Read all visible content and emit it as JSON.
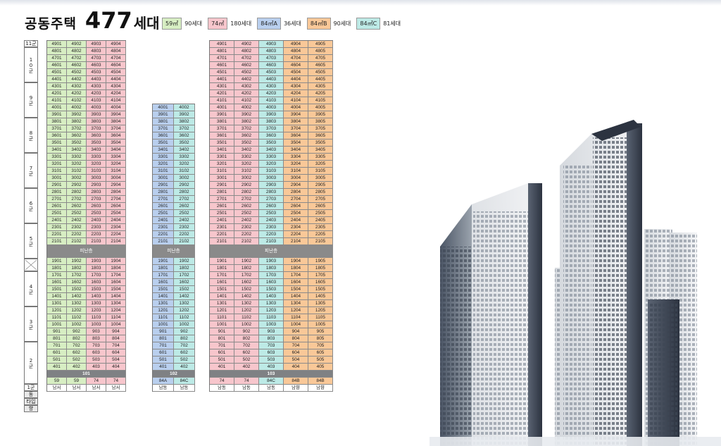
{
  "header": {
    "title_prefix": "공동주택",
    "count": "477",
    "unit": "세대"
  },
  "legend": [
    {
      "chip": "59㎡",
      "count": "90세대",
      "color": "#d7eec3"
    },
    {
      "chip": "74㎡",
      "count": "180세대",
      "color": "#f7c6cc"
    },
    {
      "chip": "84㎡A",
      "count": "36세대",
      "color": "#b9cfee"
    },
    {
      "chip": "84㎡B",
      "count": "90세대",
      "color": "#f9c898"
    },
    {
      "chip": "84㎡C",
      "count": "81세대",
      "color": "#bdeae6"
    }
  ],
  "groups": [
    {
      "label": "11군"
    },
    {
      "label": "10군"
    },
    {
      "label": "9군"
    },
    {
      "label": "8군"
    },
    {
      "label": "7군"
    },
    {
      "label": "6군"
    },
    {
      "label": "5군"
    },
    {
      "label": "4군"
    },
    {
      "label": "3군"
    },
    {
      "label": "2군"
    },
    {
      "label": "1군"
    }
  ],
  "refuge_label": "피난층",
  "footer_labels": {
    "dong": "동",
    "type": "타입",
    "direction": "향"
  },
  "buildings": [
    {
      "dong": "101",
      "top_floor": 49,
      "units": 4,
      "types": [
        "59",
        "59",
        "74",
        "74"
      ],
      "directions": [
        "남서",
        "남서",
        "남서",
        "남서"
      ],
      "colors": [
        "green",
        "green",
        "pink",
        "pink"
      ]
    },
    {
      "dong": "102",
      "top_floor": 40,
      "units": 2,
      "types": [
        "84A",
        "84C"
      ],
      "directions": [
        "남동",
        "남동"
      ],
      "colors": [
        "blue",
        "cyan"
      ]
    },
    {
      "dong": "103",
      "top_floor": 49,
      "units": 5,
      "types": [
        "74",
        "74",
        "84C",
        "84B",
        "84B"
      ],
      "directions": [
        "남동",
        "남동",
        "남동",
        "남향",
        "남향"
      ],
      "colors": [
        "pink",
        "pink",
        "cyan",
        "orange",
        "orange"
      ]
    }
  ]
}
